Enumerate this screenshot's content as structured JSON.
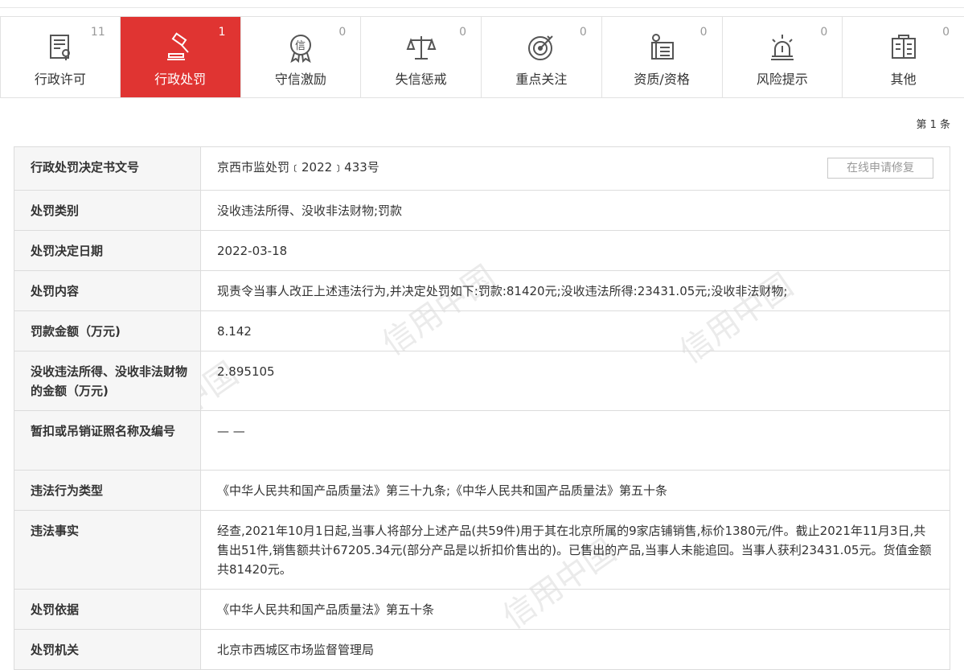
{
  "tabs": [
    {
      "label": "行政许可",
      "count": "11",
      "icon": "license-icon",
      "active": false
    },
    {
      "label": "行政处罚",
      "count": "1",
      "icon": "gavel-icon",
      "active": true
    },
    {
      "label": "守信激励",
      "count": "0",
      "icon": "credit-badge-icon",
      "active": false
    },
    {
      "label": "失信惩戒",
      "count": "0",
      "icon": "scales-icon",
      "active": false
    },
    {
      "label": "重点关注",
      "count": "0",
      "icon": "target-icon",
      "active": false
    },
    {
      "label": "资质/资格",
      "count": "0",
      "icon": "certificate-icon",
      "active": false
    },
    {
      "label": "风险提示",
      "count": "0",
      "icon": "alarm-icon",
      "active": false
    },
    {
      "label": "其他",
      "count": "0",
      "icon": "other-icon",
      "active": false
    }
  ],
  "pager": {
    "text": "第 1 条"
  },
  "fix_button": "在线申请修复",
  "watermark": "信用中国",
  "colors": {
    "accent": "#e03432",
    "header_bg": "#f6f6f6",
    "border": "#dcdcdc"
  },
  "record": [
    {
      "key": "行政处罚决定书文号",
      "value": "京西市监处罚﹝2022﹞433号"
    },
    {
      "key": "处罚类别",
      "value": "没收违法所得、没收非法财物;罚款"
    },
    {
      "key": "处罚决定日期",
      "value": "2022-03-18"
    },
    {
      "key": "处罚内容",
      "value": "现责令当事人改正上述违法行为,并决定处罚如下:罚款:81420元;没收违法所得:23431.05元;没收非法财物;"
    },
    {
      "key": "罚款金额（万元)",
      "value": "8.142"
    },
    {
      "key": "没收违法所得、没收非法财物的金额（万元)",
      "value": "2.895105"
    },
    {
      "key": "暂扣或吊销证照名称及编号",
      "value": "— —"
    },
    {
      "key": "违法行为类型",
      "value": "《中华人民共和国产品质量法》第三十九条;《中华人民共和国产品质量法》第五十条"
    },
    {
      "key": "违法事实",
      "value": "经查,2021年10月1日起,当事人将部分上述产品(共59件)用于其在北京所属的9家店铺销售,标价1380元/件。截止2021年11月3日,共售出51件,销售额共计67205.34元(部分产品是以折扣价售出的)。已售出的产品,当事人未能追回。当事人获利23431.05元。货值金额共81420元。"
    },
    {
      "key": "处罚依据",
      "value": "《中华人民共和国产品质量法》第五十条"
    },
    {
      "key": "处罚机关",
      "value": "北京市西城区市场监督管理局"
    }
  ]
}
